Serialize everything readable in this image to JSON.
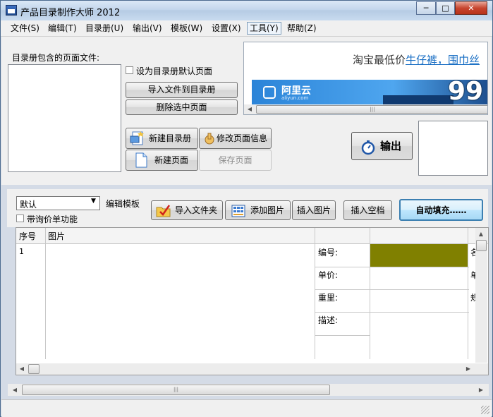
{
  "window": {
    "title": "产品目录制作大师 2012",
    "controls": {
      "minimize": "─",
      "maximize": "□",
      "close": "✕"
    }
  },
  "menu": [
    {
      "label": "文件(S)"
    },
    {
      "label": "编辑(T)"
    },
    {
      "label": "目录册(U)"
    },
    {
      "label": "输出(V)"
    },
    {
      "label": "模板(W)"
    },
    {
      "label": "设置(X)"
    },
    {
      "label": "工具(Y)"
    },
    {
      "label": "帮助(Z)"
    }
  ],
  "left_panel": {
    "list_label": "目录册包含的页面文件:",
    "default_page_checkbox": "设为目录册默认页面",
    "import_button": "导入文件到目录册",
    "delete_button": "删除选中页面",
    "new_catalog_button": "新建目录册",
    "edit_page_info_button": "修改页面信息",
    "new_page_button": "新建页面",
    "save_page_button": "保存页面"
  },
  "ad": {
    "text": "淘宝最低价",
    "link": "牛仔裤，围巾丝",
    "brand": "阿里云",
    "brand_url": "aliyun.com",
    "promo_digits": "99"
  },
  "output_button": "输出",
  "toolbar": {
    "template_select": "默认",
    "edit_template": "编辑模板",
    "inquiry_checkbox": "带询价单功能",
    "import_folder": "导入文件夹",
    "add_image": "添加图片",
    "insert_image": "插入图片",
    "insert_blank": "插入空档",
    "auto_fill": "自动填充……"
  },
  "table": {
    "headers": [
      "序号",
      "图片"
    ],
    "row_number": "1",
    "fields": [
      "编号:",
      "单价:",
      "重里:",
      "描述:"
    ],
    "clipped_chars": [
      "名",
      "单",
      "规"
    ],
    "highlight_color": "#808000"
  },
  "scrollbar_grip": "|||"
}
